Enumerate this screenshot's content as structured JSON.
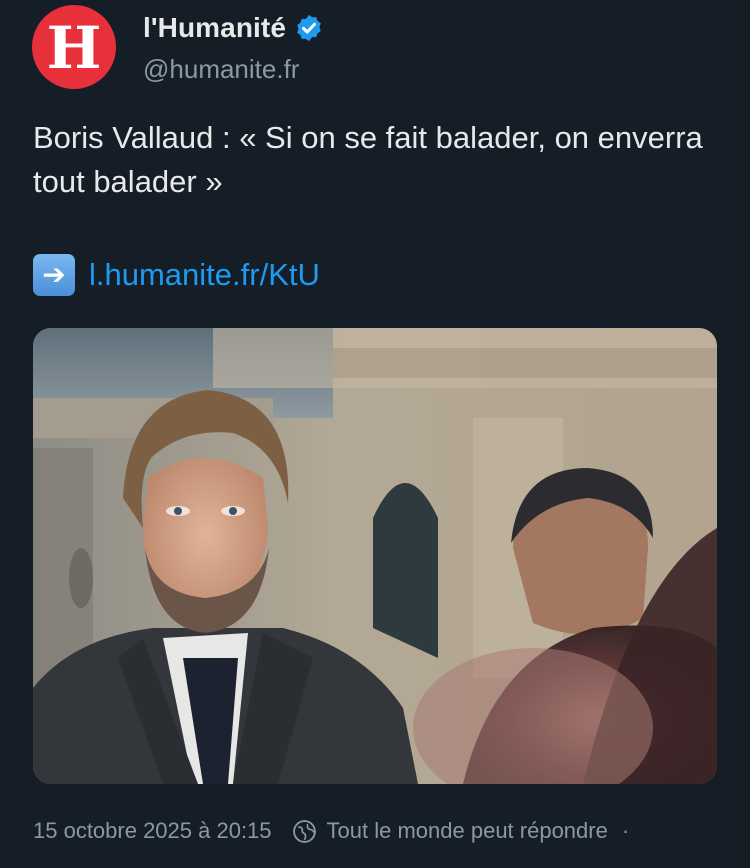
{
  "tweet": {
    "author": {
      "avatar_letter": "H",
      "display_name": "l'Humanité",
      "handle": "@humanite.fr",
      "verified": true,
      "avatar_color": "#e8303a",
      "verified_color": "#1d9bf0"
    },
    "text": "Boris Vallaud : « Si on se fait balader, on enverra tout balader »",
    "link": {
      "arrow_icon": "right-arrow-emoji",
      "text": "l.humanite.fr/KtU"
    },
    "media": {
      "type": "photo"
    },
    "footer": {
      "timestamp": "15 octobre 2025 à 20:15",
      "reply_setting_icon": "globe-icon",
      "reply_setting": "Tout le monde peut répondre",
      "separator": "·"
    }
  },
  "colors": {
    "background": "#151d27",
    "text": "#e7e9ea",
    "muted": "#8b98a5",
    "link": "#1d9bf0"
  }
}
